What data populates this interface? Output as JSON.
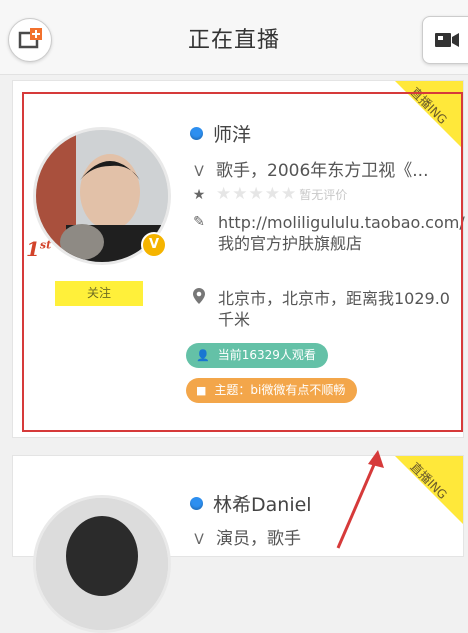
{
  "header": {
    "title": "正在直播",
    "left_icon": "add-live-icon",
    "right_icon": "video-camera-icon"
  },
  "ribbon": {
    "label": "直播ING",
    "color": "#ffe83a"
  },
  "cards": [
    {
      "name": "师洋",
      "rank_num": "1",
      "rank_suffix": "st",
      "verified": "V",
      "follow_label": "关注",
      "profession_prefix": "V",
      "profession": "歌手，2006年东方卫视《...",
      "stars": "★★★★★",
      "rating_text": "暂无评价",
      "link_text": "http://moliligululu.taobao.com/ 我的官方护肤旗舰店",
      "location": "北京市，北京市，距离我1029.0千米",
      "viewers": "当前16329人观看",
      "topic": "主题：bi微微有点不顺畅"
    },
    {
      "name": "林希Daniel",
      "profession_prefix": "V",
      "profession": "演员，歌手"
    }
  ],
  "colors": {
    "highlight": "#d63a3a",
    "follow": "#fff03a",
    "viewers_pill": "#64c1a7",
    "topic_pill": "#f3a64a",
    "status_dot": "#2d8ff0"
  }
}
